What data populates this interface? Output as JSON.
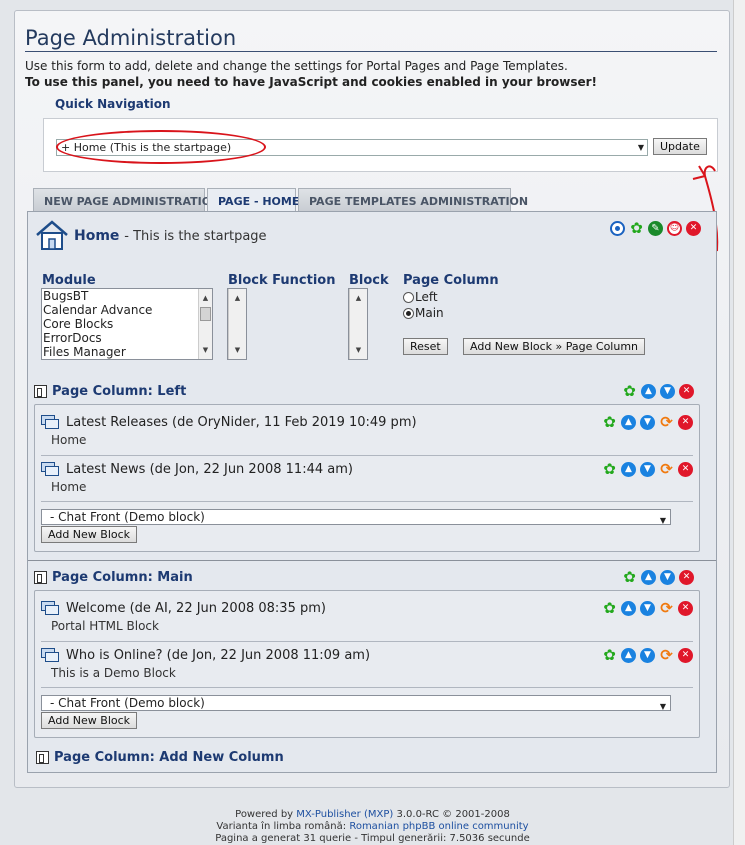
{
  "page": {
    "title": "Page Administration",
    "description": "Use this form to add, delete and change the settings for Portal Pages and Page Templates.",
    "warning": "To use this panel, you need to have JavaScript and cookies enabled in your browser!"
  },
  "quick_nav": {
    "label": "Quick Navigation",
    "selected": "+ Home (This is the startpage)",
    "update_label": "Update"
  },
  "tabs": [
    {
      "label": "NEW PAGE ADMINISTRATION",
      "active": false
    },
    {
      "label": "PAGE - HOME",
      "active": true
    },
    {
      "label": "PAGE TEMPLATES ADMINISTRATION",
      "active": false
    }
  ],
  "home": {
    "title": "Home",
    "subtitle": "- This is the startpage"
  },
  "form": {
    "module_label": "Module",
    "modules": [
      "BugsBT",
      "Calendar Advance",
      "Core Blocks",
      "ErrorDocs",
      "Files Manager"
    ],
    "block_function_label": "Block Function",
    "block_label": "Block",
    "page_column_label": "Page Column",
    "radio_left": "Left",
    "radio_main": "Main",
    "reset_label": "Reset",
    "add_block_label": "Add New Block » Page Column"
  },
  "columns": [
    {
      "title": "Page Column: Left",
      "blocks": [
        {
          "title": "Latest Releases (de OryNider, 11 Feb 2019 10:49 pm)",
          "sub": "Home"
        },
        {
          "title": "Latest News (de Jon, 22 Jun 2008 11:44 am)",
          "sub": "Home"
        }
      ],
      "select_value": "- Chat Front (Demo block)",
      "add_label": "Add New Block"
    },
    {
      "title": "Page Column: Main",
      "blocks": [
        {
          "title": "Welcome (de AI, 22 Jun 2008 08:35 pm)",
          "sub": "Portal HTML Block"
        },
        {
          "title": "Who is Online? (de Jon, 22 Jun 2008 11:09 am)",
          "sub": "This is a Demo Block"
        }
      ],
      "select_value": "- Chat Front (Demo block)",
      "add_label": "Add New Block"
    }
  ],
  "add_column": {
    "title": "Page Column: Add New Column"
  },
  "footer": {
    "line1_prefix": "Powered by",
    "line1_link": "MX-Publisher (MXP)",
    "line1_suffix": "3.0.0-RC © 2001-2008",
    "line2_prefix": "Varianta în limba română:",
    "line2_link": "Romanian phpBB online community",
    "line3": "Pagina a generat 31 querie - Timpul generării: 7.5036 secunde"
  },
  "colors": {
    "accent": "#1d3a72",
    "annotation": "#d9141b"
  }
}
